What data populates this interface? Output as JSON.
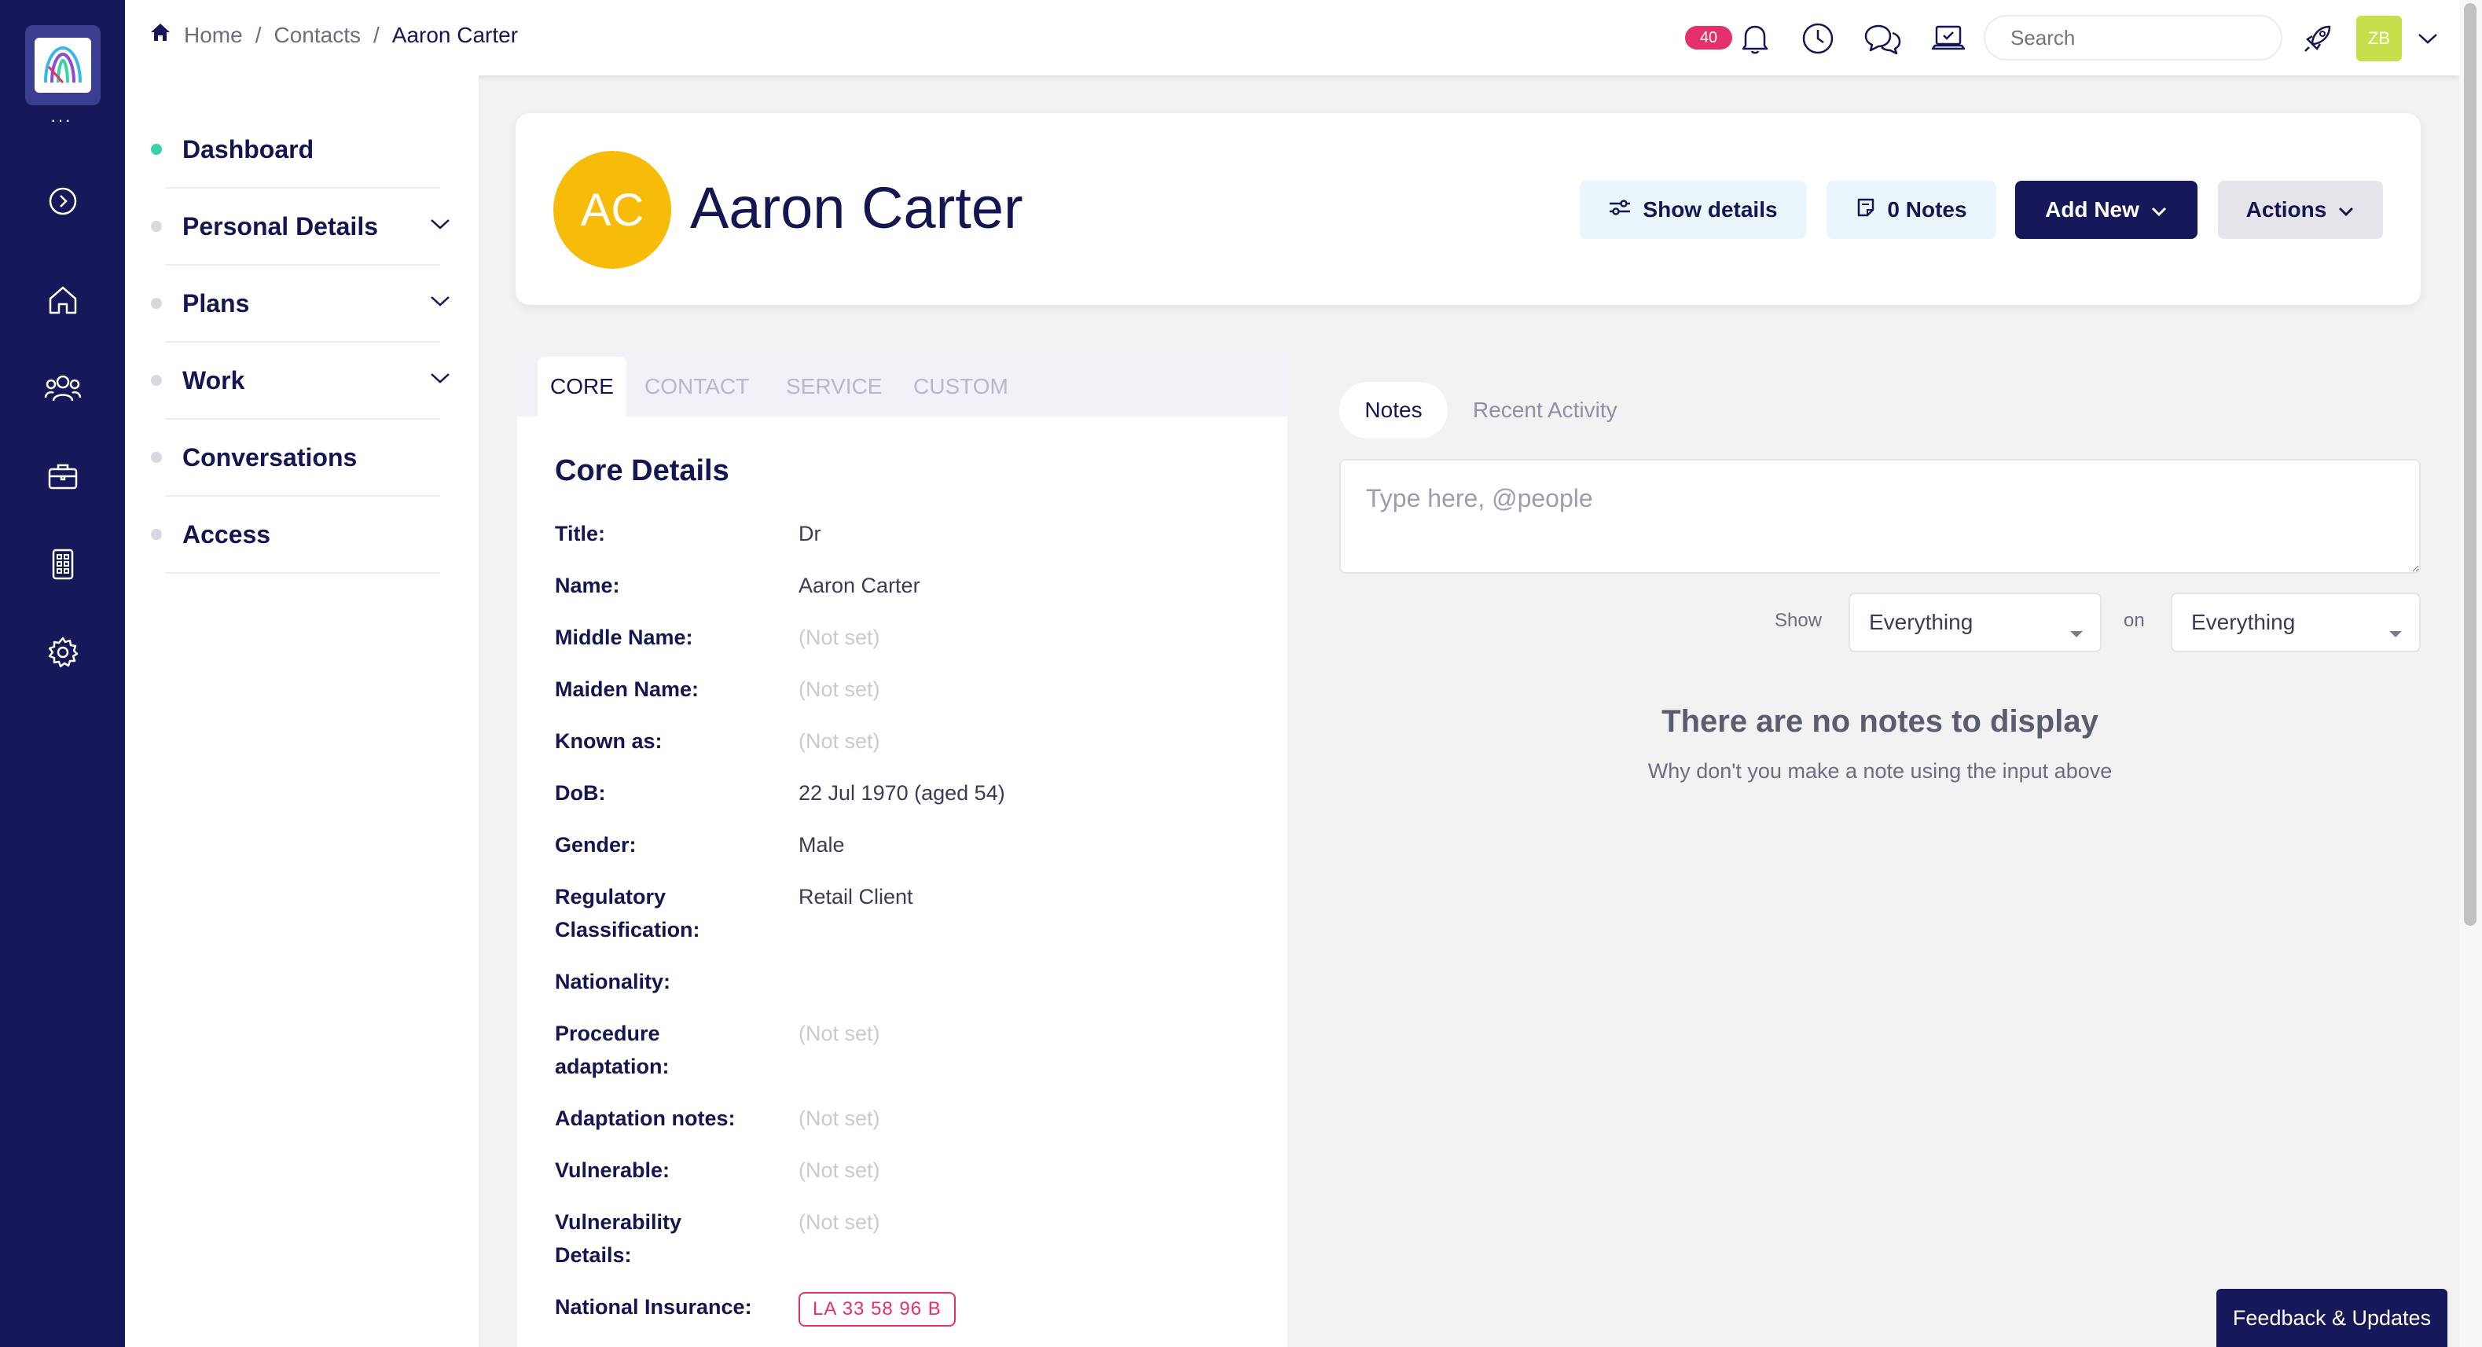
{
  "breadcrumb": {
    "home": "Home",
    "sep1": "/",
    "contacts": "Contacts",
    "sep2": "/",
    "current": "Aaron Carter"
  },
  "topbar": {
    "notification_count": "40",
    "search_placeholder": "Search",
    "user_initials": "ZB"
  },
  "rail": {
    "dots": "···",
    "icons": [
      "expand-icon",
      "home-icon",
      "people-icon",
      "briefcase-icon",
      "calculator-icon",
      "settings-icon"
    ]
  },
  "sidebar": {
    "items": [
      {
        "label": "Dashboard",
        "active": true,
        "expandable": false
      },
      {
        "label": "Personal Details",
        "active": false,
        "expandable": true
      },
      {
        "label": "Plans",
        "active": false,
        "expandable": true
      },
      {
        "label": "Work",
        "active": false,
        "expandable": true
      },
      {
        "label": "Conversations",
        "active": false,
        "expandable": false
      },
      {
        "label": "Access",
        "active": false,
        "expandable": false
      }
    ]
  },
  "header": {
    "initials": "AC",
    "name": "Aaron Carter",
    "show_details": "Show details",
    "notes": "0 Notes",
    "add_new": "Add New",
    "actions": "Actions"
  },
  "tabs": [
    "CORE",
    "CONTACT",
    "SERVICE",
    "CUSTOM"
  ],
  "core": {
    "title": "Core Details",
    "rows": [
      {
        "label": "Title:",
        "value": "Dr",
        "unset": false
      },
      {
        "label": "Name:",
        "value": "Aaron Carter",
        "unset": false
      },
      {
        "label": "Middle Name:",
        "value": "(Not set)",
        "unset": true
      },
      {
        "label": "Maiden Name:",
        "value": "(Not set)",
        "unset": true
      },
      {
        "label": "Known as:",
        "value": "(Not set)",
        "unset": true
      },
      {
        "label": "DoB:",
        "value": "22 Jul 1970 (aged 54)",
        "unset": false
      },
      {
        "label": "Gender:",
        "value": "Male",
        "unset": false
      },
      {
        "label": "Regulatory Classification:",
        "value": "Retail Client",
        "unset": false
      },
      {
        "label": "Nationality:",
        "value": "",
        "unset": false
      },
      {
        "label": "Procedure adaptation:",
        "value": "(Not set)",
        "unset": true
      },
      {
        "label": "Adaptation notes:",
        "value": "(Not set)",
        "unset": true
      },
      {
        "label": "Vulnerable:",
        "value": "(Not set)",
        "unset": true
      },
      {
        "label": "Vulnerability Details:",
        "value": "(Not set)",
        "unset": true
      },
      {
        "label": "National Insurance:",
        "value": "LA 33 58 96 B",
        "unset": false
      }
    ]
  },
  "notes_panel": {
    "tab_notes": "Notes",
    "tab_activity": "Recent Activity",
    "input_placeholder": "Type here, @people",
    "show_label": "Show",
    "show_value": "Everything",
    "on_label": "on",
    "on_value": "Everything",
    "empty_title": "There are no notes to display",
    "empty_subtitle": "Why don't you make a note using the input above"
  },
  "feedback": "Feedback & Updates"
}
